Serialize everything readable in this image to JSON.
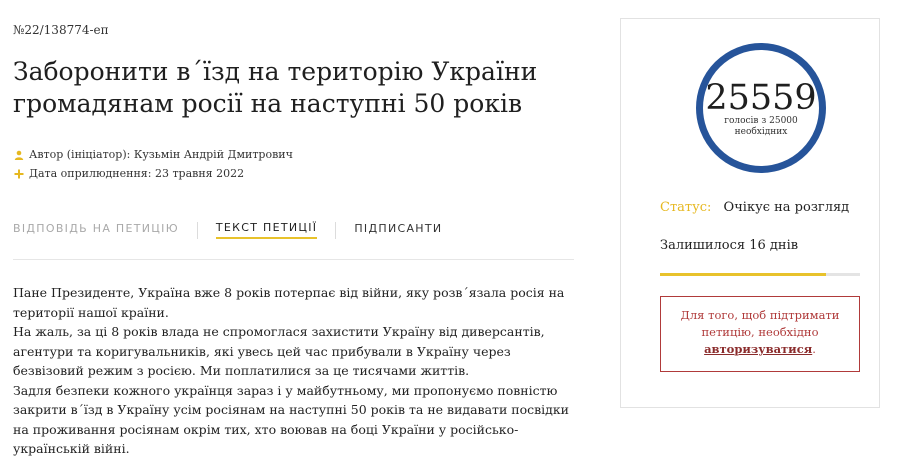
{
  "petition": {
    "number": "№22/138774-еп",
    "title": "Заборонити в´їзд на територію України громадянам росії на наступні 50 років",
    "author": "Автор (ініціатор): Кузьмін Андрій Дмитрович",
    "date": "Дата оприлюднення: 23 травня 2022"
  },
  "icons": {
    "author": "person-icon",
    "date": "plus-icon"
  },
  "tabs": [
    {
      "label": "Відповідь на петицію",
      "state": "disabled"
    },
    {
      "label": "Текст петиції",
      "state": "active"
    },
    {
      "label": "Підписанти",
      "state": "normal"
    }
  ],
  "body": {
    "paragraphs": [
      "Пане Президенте, Україна вже 8 років потерпає від війни, яку розв´язала росія на території нашої країни.",
      "На жаль, за ці 8 років влада не спромоглася захистити Україну від диверсантів, агентури та коригувальників, які увесь цей час прибували в Україну через безвізовий режим з росією. Ми поплатилися за це тисячами життів.",
      "Задля безпеки кожного українця зараз і у майбутньому, ми пропонуємо повністю закрити в´їзд в Україну усім росіянам на наступні 50 років та не видавати посвідки на проживання росіянам окрім тих, хто воював на боці України у російсько-українській війні."
    ]
  },
  "sidebar": {
    "votes": "25559",
    "votes_caption": "голосів з 25000 необхідних",
    "status_label": "Статус:",
    "status_value": "Очікує на розгляд",
    "remaining": "Залишилося 16 днів",
    "progress_fraction": 0.83,
    "notice_text": "Для того, щоб підтримати петицію, необхідно",
    "notice_link": "авторизуватися",
    "notice_end": "."
  },
  "colors": {
    "accent": "#e8c22b",
    "circle": "#26549a",
    "notice": "#b03a3a"
  }
}
